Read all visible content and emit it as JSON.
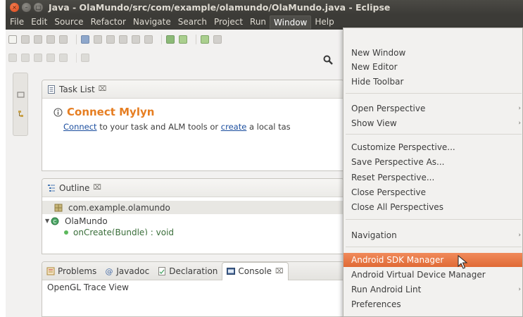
{
  "window": {
    "title": "Java - OlaMundo/src/com/example/olamundo/OlaMundo.java - Eclipse",
    "close_glyph": "×",
    "minimize_glyph": "–",
    "maximize_glyph": "□"
  },
  "menubar": {
    "items": [
      "File",
      "Edit",
      "Source",
      "Refactor",
      "Navigate",
      "Search",
      "Project",
      "Run",
      "Window",
      "Help"
    ],
    "active": "Window"
  },
  "task_list": {
    "tab_label": "Task List",
    "close_glyph": "⌧",
    "mylyn_title": "Connect Mylyn",
    "line_link1": "Connect",
    "line_middle": " to your task and ALM tools or ",
    "line_link2": "create",
    "line_tail": " a local tas"
  },
  "outline": {
    "tab_label": "Outline",
    "close_glyph": "⌧",
    "rows": [
      "com.example.olamundo",
      "OlaMundo",
      "onCreate(Bundle) : void"
    ]
  },
  "bottom_panel": {
    "tabs": [
      "Problems",
      "Javadoc",
      "Declaration",
      "Console"
    ],
    "active_tab": "Console",
    "close_glyph": "⌧",
    "content": "OpenGL Trace View"
  },
  "window_menu": {
    "items": [
      {
        "label": "New Window",
        "submenu": false
      },
      {
        "label": "New Editor",
        "submenu": false
      },
      {
        "label": "Hide Toolbar",
        "submenu": false
      },
      {
        "label": "Open Perspective",
        "submenu": true
      },
      {
        "label": "Show View",
        "submenu": true
      },
      {
        "label": "Customize Perspective...",
        "submenu": false
      },
      {
        "label": "Save Perspective As...",
        "submenu": false
      },
      {
        "label": "Reset Perspective...",
        "submenu": false
      },
      {
        "label": "Close Perspective",
        "submenu": false
      },
      {
        "label": "Close All Perspectives",
        "submenu": false
      },
      {
        "label": "Navigation",
        "submenu": true
      },
      {
        "label": "Android SDK Manager",
        "submenu": false,
        "highlighted": true
      },
      {
        "label": "Android Virtual Device Manager",
        "submenu": false
      },
      {
        "label": "Run Android Lint",
        "submenu": true
      },
      {
        "label": "Preferences",
        "submenu": false
      }
    ],
    "submenu_arrow": "›"
  },
  "colors": {
    "menubar_bg": "#3c3b37",
    "highlight": "#e9743f",
    "mylyn_orange": "#e67e22",
    "link": "#1a4d9e"
  },
  "icons": [
    "close-window-icon",
    "minimize-icon",
    "maximize-icon",
    "search-icon",
    "task-list-icon",
    "info-icon",
    "outline-icon",
    "package-icon",
    "class-icon",
    "method-icon",
    "problems-icon",
    "javadoc-icon",
    "declaration-icon",
    "console-icon",
    "mouse-cursor-icon"
  ]
}
